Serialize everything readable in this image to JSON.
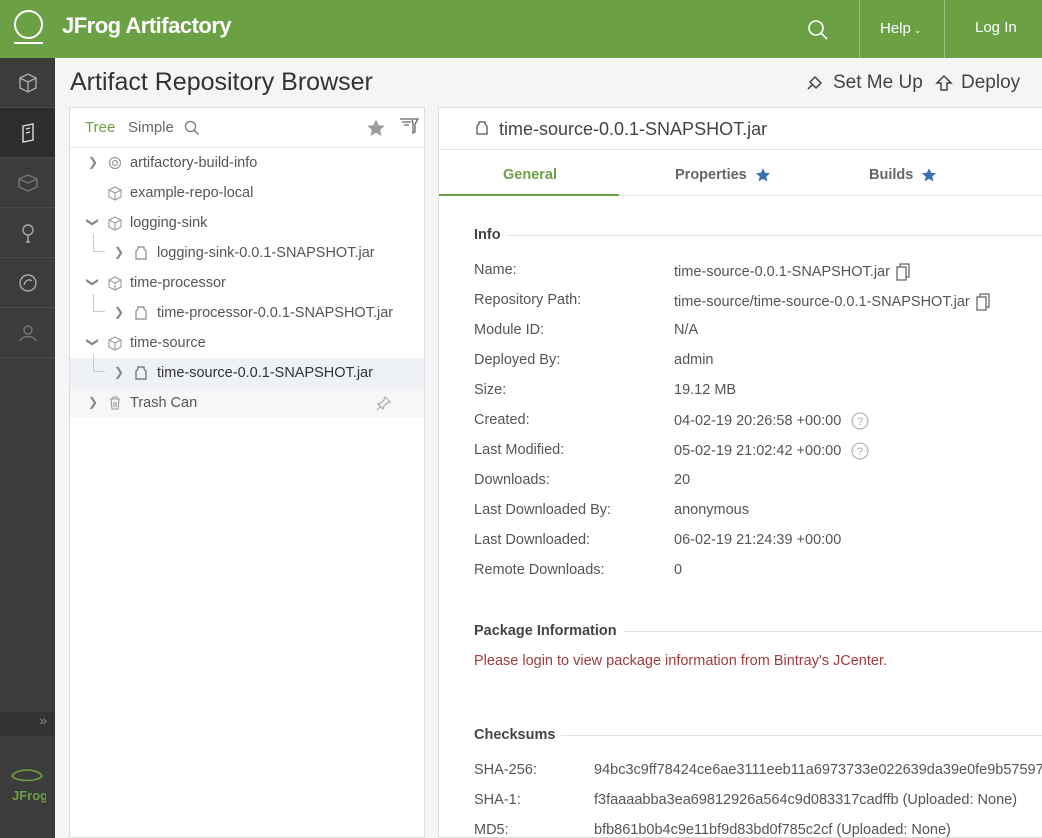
{
  "topbar": {
    "brand": "JFrog Artifactory",
    "help_label": "Help",
    "login_label": "Log In"
  },
  "page": {
    "title": "Artifact Repository Browser",
    "set_me_up_label": "Set Me Up",
    "deploy_label": "Deploy"
  },
  "tree": {
    "tab_tree": "Tree",
    "tab_simple": "Simple",
    "items": [
      {
        "label": "artifactory-build-info"
      },
      {
        "label": "example-repo-local"
      },
      {
        "label": "logging-sink"
      },
      {
        "label": "logging-sink-0.0.1-SNAPSHOT.jar"
      },
      {
        "label": "time-processor"
      },
      {
        "label": "time-processor-0.0.1-SNAPSHOT.jar"
      },
      {
        "label": "time-source"
      },
      {
        "label": "time-source-0.0.1-SNAPSHOT.jar"
      },
      {
        "label": "Trash Can"
      }
    ]
  },
  "detail": {
    "title": "time-source-0.0.1-SNAPSHOT.jar",
    "tabs": [
      {
        "label": "General"
      },
      {
        "label": "Properties"
      },
      {
        "label": "Builds"
      }
    ],
    "info_title": "Info",
    "info": [
      {
        "key": "Name:",
        "value": "time-source-0.0.1-SNAPSHOT.jar"
      },
      {
        "key": "Repository Path:",
        "value": "time-source/time-source-0.0.1-SNAPSHOT.jar"
      },
      {
        "key": "Module ID:",
        "value": "N/A"
      },
      {
        "key": "Deployed By:",
        "value": "admin"
      },
      {
        "key": "Size:",
        "value": "19.12 MB"
      },
      {
        "key": "Created:",
        "value": "04-02-19 20:26:58 +00:00"
      },
      {
        "key": "Last Modified:",
        "value": "05-02-19 21:02:42 +00:00"
      },
      {
        "key": "Downloads:",
        "value": "20"
      },
      {
        "key": "Last Downloaded By:",
        "value": "anonymous"
      },
      {
        "key": "Last Downloaded:",
        "value": "06-02-19 21:24:39 +00:00"
      },
      {
        "key": "Remote Downloads:",
        "value": "0"
      }
    ],
    "package_title": "Package Information",
    "package_message": "Please login to view package information from Bintray's JCenter.",
    "checksums_title": "Checksums",
    "checksums": [
      {
        "key": "SHA-256:",
        "value": "94bc3c9ff78424ce6ae3111eeb11a6973733e022639da39e0fe9b57597"
      },
      {
        "key": "SHA-1:",
        "value": "f3faaaabba3ea69812926a564c9d083317cadffb (Uploaded: None)"
      },
      {
        "key": "MD5:",
        "value": "bfb861b0b4c9e11bf9d83bd0f785c2cf (Uploaded: None)"
      }
    ]
  },
  "colors": {
    "brand_green": "#6ba044",
    "nav_dark": "#3c3c3c",
    "warning_red": "#a03c3c",
    "star_blue": "#3a6fb0"
  }
}
